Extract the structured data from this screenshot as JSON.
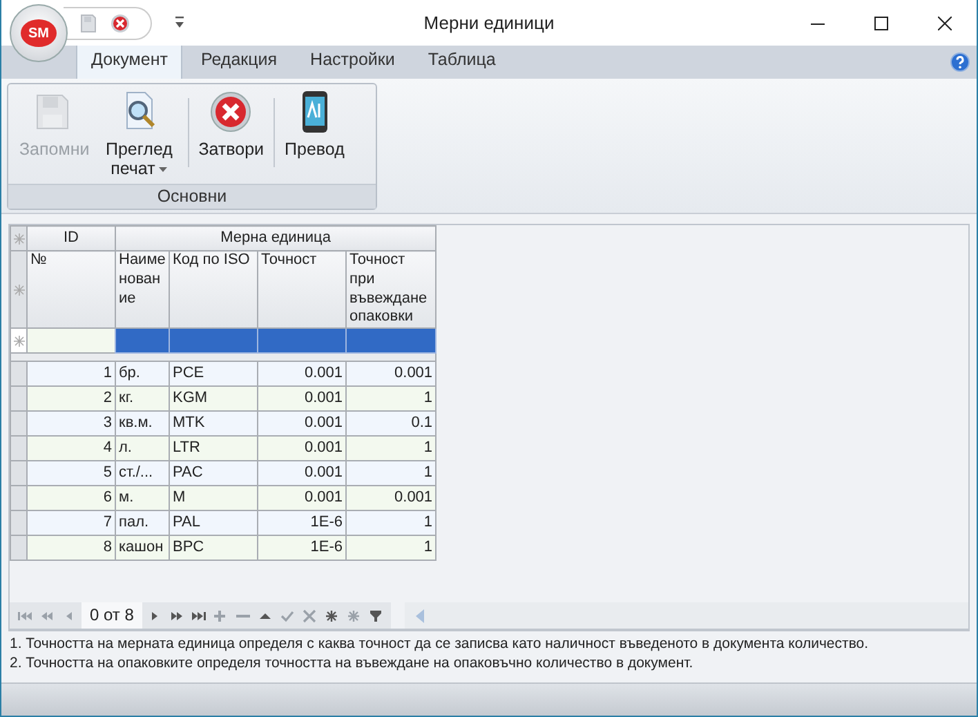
{
  "window": {
    "title": "Мерни единици",
    "logo_text": "SM"
  },
  "tabs": [
    {
      "label": "Документ",
      "selected": true
    },
    {
      "label": "Редакция",
      "selected": false
    },
    {
      "label": "Настройки",
      "selected": false
    },
    {
      "label": "Таблица",
      "selected": false
    }
  ],
  "ribbon": {
    "group_label": "Основни",
    "buttons": [
      {
        "kind": "save",
        "label": "Запомни",
        "disabled": true,
        "has_menu": false
      },
      {
        "kind": "preview",
        "label": "Преглед печат",
        "disabled": false,
        "has_menu": true
      },
      {
        "kind": "close",
        "label": "Затвори",
        "disabled": false,
        "has_menu": false
      },
      {
        "kind": "translate",
        "label": "Превод",
        "disabled": false,
        "has_menu": false
      }
    ]
  },
  "grid": {
    "bands": [
      "ID",
      "Мерна единица"
    ],
    "columns": [
      "№",
      "Наименование",
      "Код по ISO",
      "Точност",
      "Точност при въвеждане опаковки"
    ],
    "new_row": {
      "selected": true
    },
    "rows": [
      [
        "1",
        "бр.",
        "PCE",
        "0.001",
        "0.001"
      ],
      [
        "2",
        "кг.",
        "KGM",
        "0.001",
        "1"
      ],
      [
        "3",
        "кв.м.",
        "MTK",
        "0.001",
        "0.1"
      ],
      [
        "4",
        "л.",
        "LTR",
        "0.001",
        "1"
      ],
      [
        "5",
        "ст./...",
        "PAC",
        "0.001",
        "1"
      ],
      [
        "6",
        "м.",
        "M",
        "0.001",
        "0.001"
      ],
      [
        "7",
        "пал.",
        "PAL",
        "1E-6",
        "1"
      ],
      [
        "8",
        "кашон",
        "BPC",
        "1E-6",
        "1"
      ]
    ]
  },
  "navigator": {
    "position": "0 от 8"
  },
  "notes": [
    "1. Точността на мерната единица определя с каква точност да се записва като наличност въведеното в документа количество.",
    "2. Точността на опаковките определя точността на въвеждане на опаковъчно количество в документ."
  ]
}
